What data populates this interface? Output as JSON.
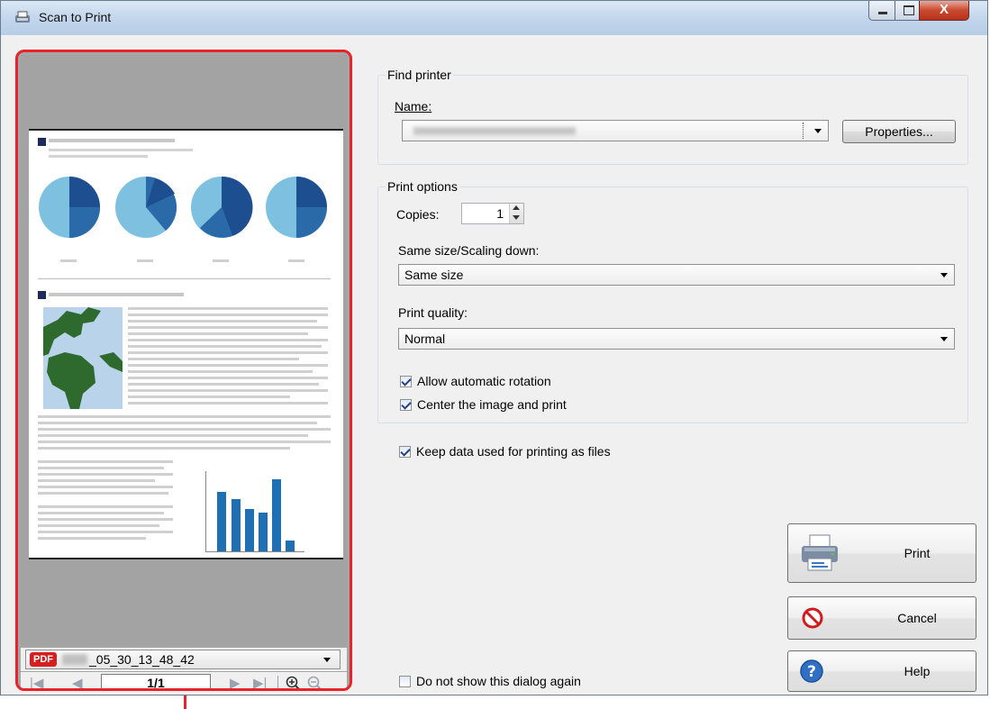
{
  "window": {
    "title": "Scan to Print"
  },
  "preview": {
    "filename": "_05_30_13_48_42",
    "pdf_badge": "PDF",
    "page_indicator": "1/1"
  },
  "find_printer": {
    "group_label": "Find printer",
    "name_label": "Name:",
    "properties_button": "Properties..."
  },
  "print_options": {
    "group_label": "Print options",
    "copies_label": "Copies:",
    "copies_value": "1",
    "scaling_label": "Same size/Scaling down:",
    "scaling_value": "Same size",
    "quality_label": "Print quality:",
    "quality_value": "Normal",
    "allow_rotation_label": "Allow automatic rotation",
    "allow_rotation_checked": true,
    "center_image_label": "Center the image and print",
    "center_image_checked": true
  },
  "keep_data": {
    "label": "Keep data used for printing as files",
    "checked": true
  },
  "do_not_show": {
    "label": "Do not show this dialog again",
    "checked": false
  },
  "buttons": {
    "print": "Print",
    "cancel": "Cancel",
    "help": "Help"
  }
}
